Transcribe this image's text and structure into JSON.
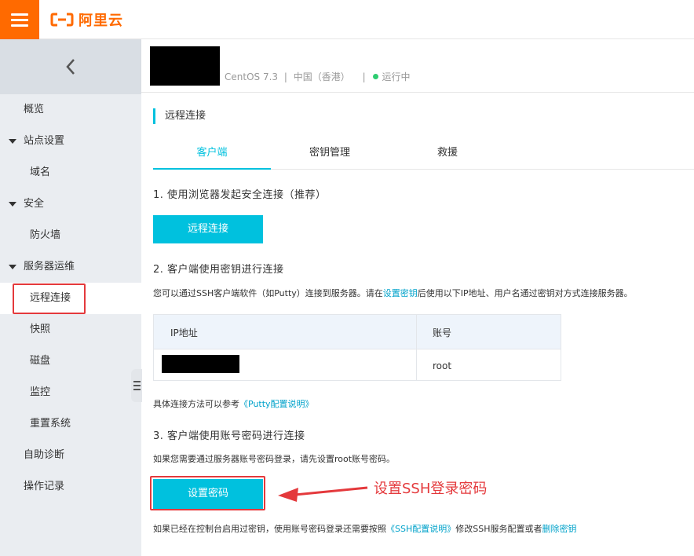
{
  "topbar": {
    "brand": "阿里云"
  },
  "sidebar": {
    "items": [
      {
        "label": "概览"
      },
      {
        "label": "站点设置"
      },
      {
        "label": "域名"
      },
      {
        "label": "安全"
      },
      {
        "label": "防火墙"
      },
      {
        "label": "服务器运维"
      },
      {
        "label": "远程连接"
      },
      {
        "label": "快照"
      },
      {
        "label": "磁盘"
      },
      {
        "label": "监控"
      },
      {
        "label": "重置系统"
      },
      {
        "label": "自助诊断"
      },
      {
        "label": "操作记录"
      }
    ]
  },
  "instance": {
    "os": "CentOS 7.3",
    "region": "中国（香港）",
    "separator": "|",
    "status": "运行中"
  },
  "section": {
    "title": "远程连接"
  },
  "tabs": [
    {
      "label": "客户端"
    },
    {
      "label": "密钥管理"
    },
    {
      "label": "救援"
    }
  ],
  "step1": {
    "title": "1. 使用浏览器发起安全连接（推荐）",
    "button": "远程连接"
  },
  "step2": {
    "title": "2. 客户端使用密钥进行连接",
    "desc_before": "您可以通过SSH客户端软件（如Putty）连接到服务器。请在",
    "desc_link": "设置密钥",
    "desc_after": "后使用以下IP地址、用户名通过密钥对方式连接服务器。",
    "table": {
      "col_ip": "IP地址",
      "col_account": "账号",
      "account_value": "root"
    },
    "ref_before": "具体连接方法可以参考",
    "ref_link": "《Putty配置说明》"
  },
  "step3": {
    "title": "3. 客户端使用账号密码进行连接",
    "desc": "如果您需要通过服务器账号密码登录，请先设置root账号密码。",
    "button": "设置密码",
    "footer_before": "如果已经在控制台启用过密钥，使用账号密码登录还需要按照",
    "footer_link1": "《SSH配置说明》",
    "footer_mid": "修改SSH服务配置或者",
    "footer_link2": "删除密钥"
  },
  "annotation": {
    "text": "设置SSH登录密码"
  }
}
